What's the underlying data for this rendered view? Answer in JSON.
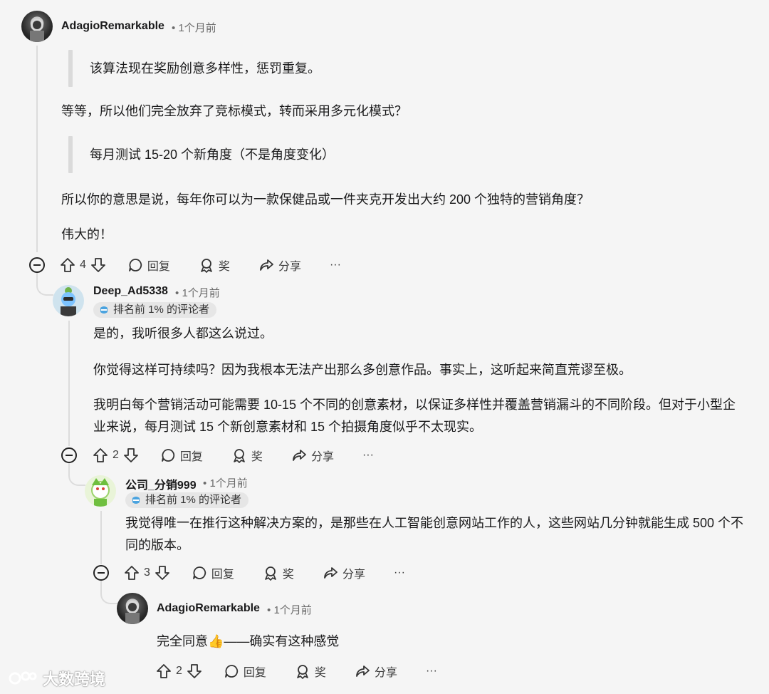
{
  "comments": [
    {
      "username": "AdagioRemarkable",
      "time": "1个月前",
      "blocks": [
        {
          "type": "quote",
          "text": "该算法现在奖励创意多样性，惩罚重复。"
        },
        {
          "type": "para",
          "text": "等等，所以他们完全放弃了竞标模式，转而采用多元化模式？"
        },
        {
          "type": "quote",
          "text": "每月测试 15-20 个新角度（不是角度变化）"
        },
        {
          "type": "para",
          "text": "所以你的意思是说，每年你可以为一款保健品或一件夹克开发出大约 200 个独特的营销角度？"
        },
        {
          "type": "para",
          "text": "伟大的！"
        }
      ],
      "votes": "4"
    },
    {
      "username": "Deep_Ad5338",
      "time": "1个月前",
      "flair": "排名前 1% 的评论者",
      "blocks": [
        {
          "type": "para",
          "text": "是的，我听很多人都这么说过。"
        },
        {
          "type": "para",
          "text": "你觉得这样可持续吗？因为我根本无法产出那么多创意作品。事实上，这听起来简直荒谬至极。"
        },
        {
          "type": "para",
          "text": "我明白每个营销活动可能需要 10-15 个不同的创意素材，以保证多样性并覆盖营销漏斗的不同阶段。但对于小型企业来说，每月测试 15 个新创意素材和 15 个拍摄角度似乎不太现实。"
        }
      ],
      "votes": "2"
    },
    {
      "username": "公司_分销999",
      "time": "1个月前",
      "flair": "排名前 1% 的评论者",
      "blocks": [
        {
          "type": "para",
          "text": "我觉得唯一在推行这种解决方案的，是那些在人工智能创意网站工作的人，这些网站几分钟就能生成 500 个不同的版本。"
        }
      ],
      "votes": "3"
    },
    {
      "username": "AdagioRemarkable",
      "time": "1个月前",
      "blocks": [
        {
          "type": "para",
          "text": "完全同意👍——确实有这种感觉"
        }
      ],
      "votes": "2"
    }
  ],
  "actions": {
    "reply": "回复",
    "award": "奖",
    "share": "分享",
    "more": "···"
  },
  "separator": "•",
  "watermark": "大数跨境",
  "icons": [
    "upvote-icon",
    "downvote-icon",
    "comment-icon",
    "award-icon",
    "share-icon",
    "more-icon",
    "collapse-icon",
    "flair-badge-icon"
  ]
}
